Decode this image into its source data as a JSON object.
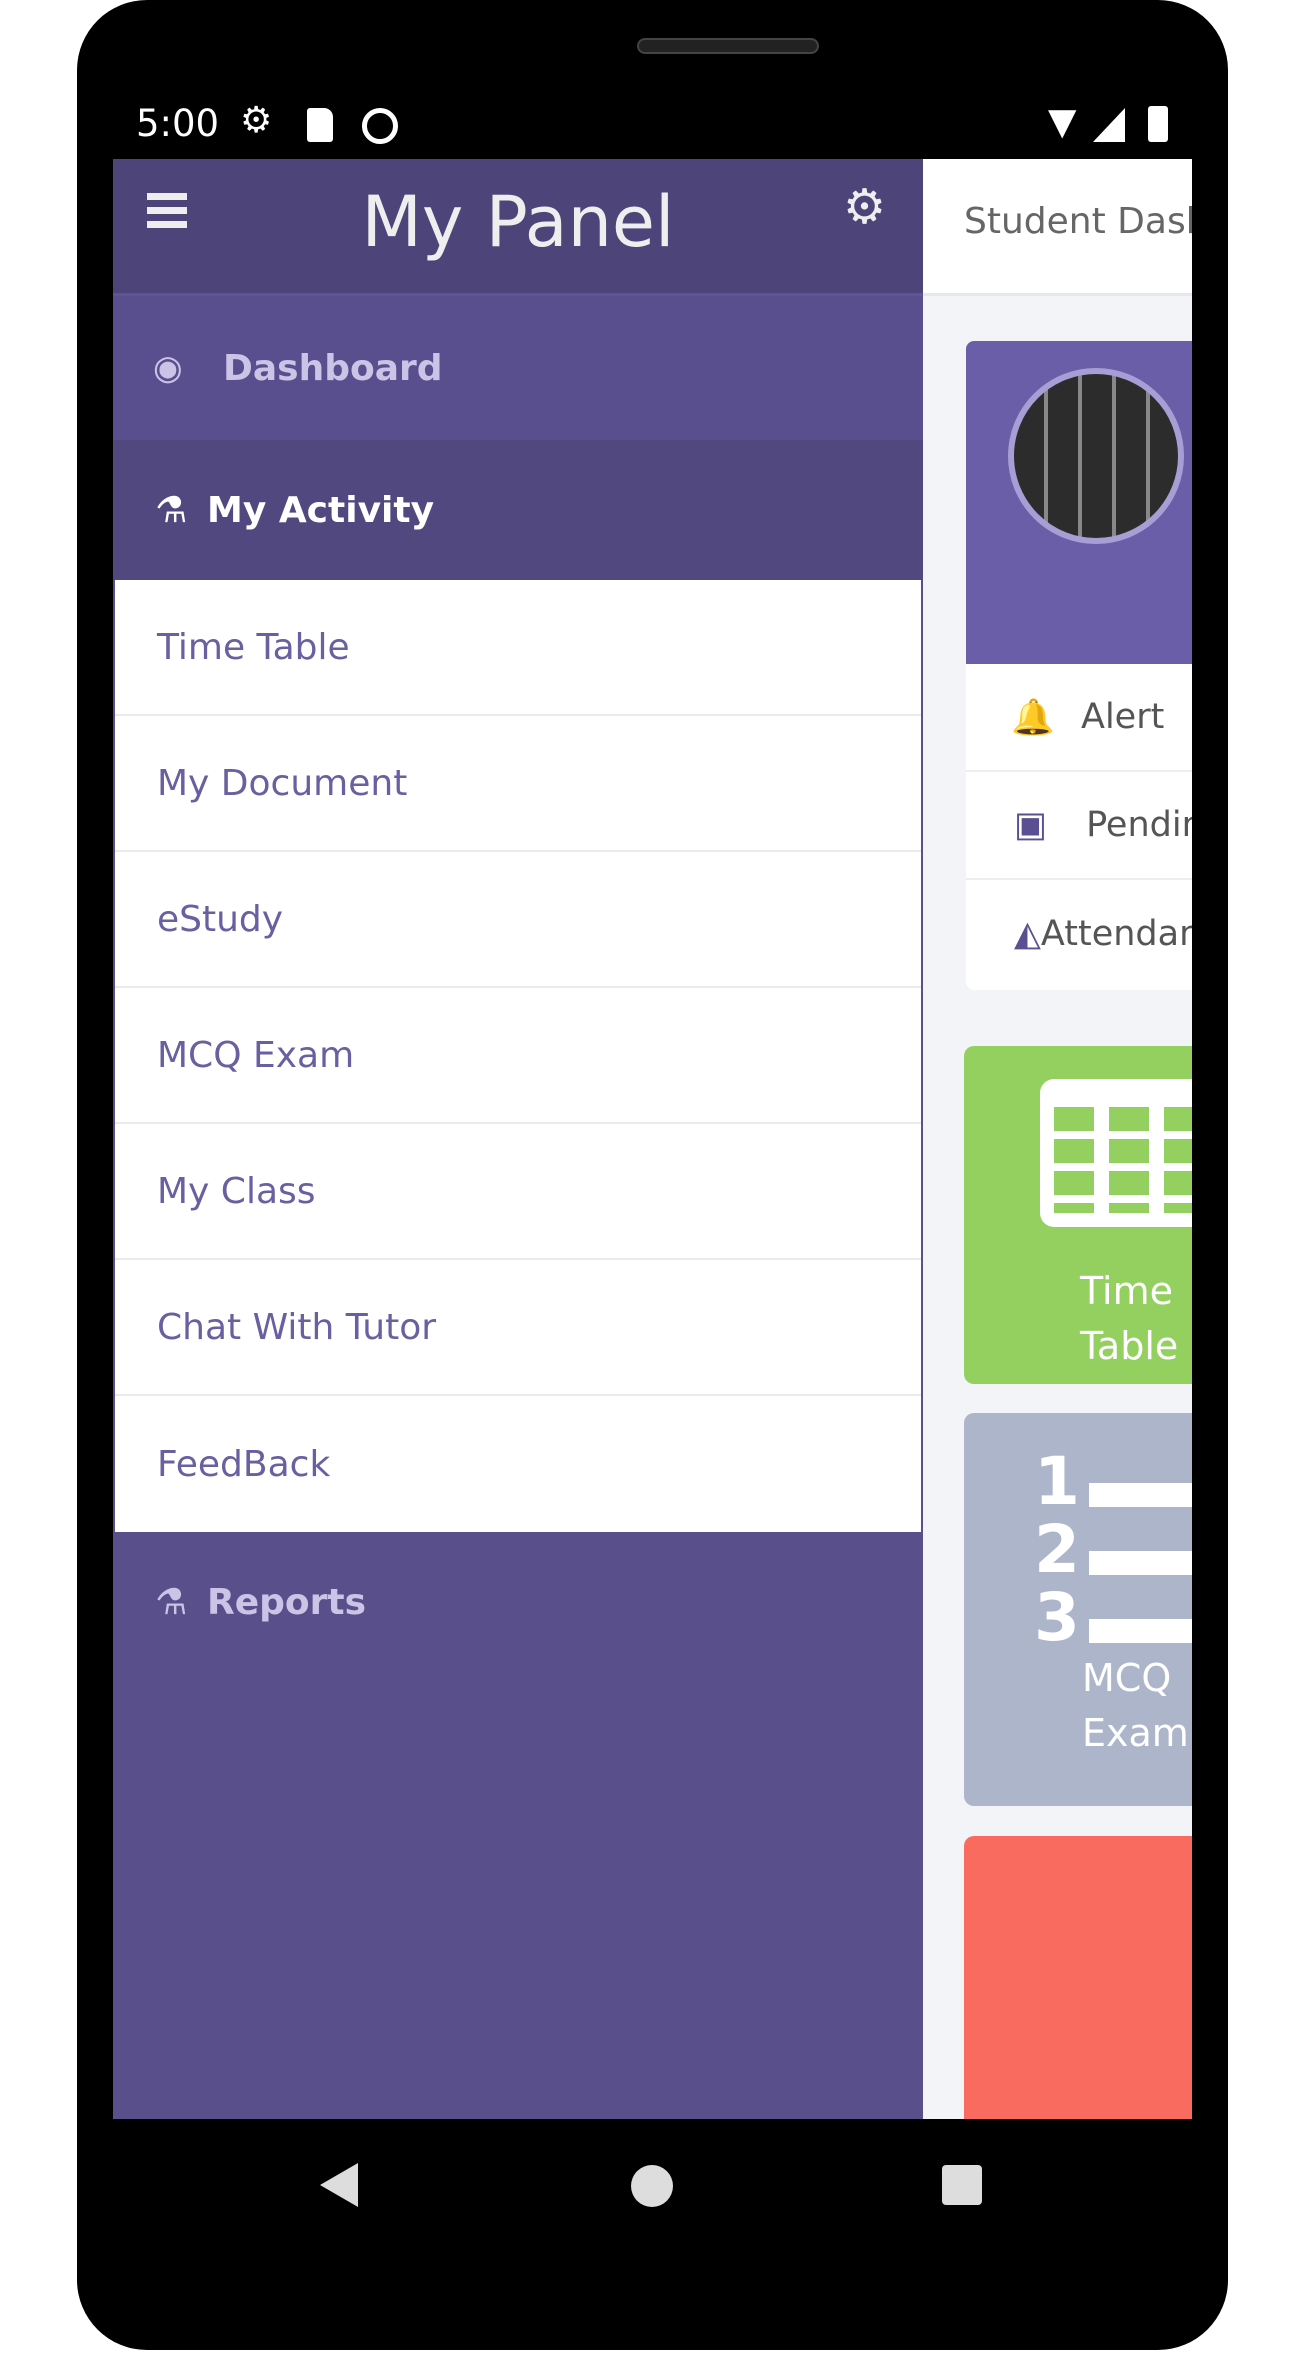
{
  "status_bar": {
    "time": "5:00",
    "icons": [
      "gear-icon",
      "sd-card-icon",
      "data-saver-icon",
      "wifi-icon",
      "signal-icon",
      "battery-icon"
    ]
  },
  "drawer": {
    "title": "My Panel",
    "sections": {
      "dashboard": "Dashboard",
      "my_activity": "My Activity",
      "reports": "Reports"
    },
    "items": [
      "Time Table",
      "My Document",
      "eStudy",
      "MCQ Exam",
      "My Class",
      "Chat With Tutor",
      "FeedBack"
    ]
  },
  "main": {
    "header_title": "Student Dashboard",
    "profile_rows": [
      "Alert",
      "Pending",
      "Attendance"
    ],
    "tiles": [
      "Time Table",
      "MCQ Exam"
    ]
  },
  "colors": {
    "drawer": "#594f8b",
    "header": "#4d4479",
    "card_purple": "#6b5ea8",
    "green": "#94d05f",
    "gray": "#adb5ca",
    "red": "#f86b5e"
  }
}
